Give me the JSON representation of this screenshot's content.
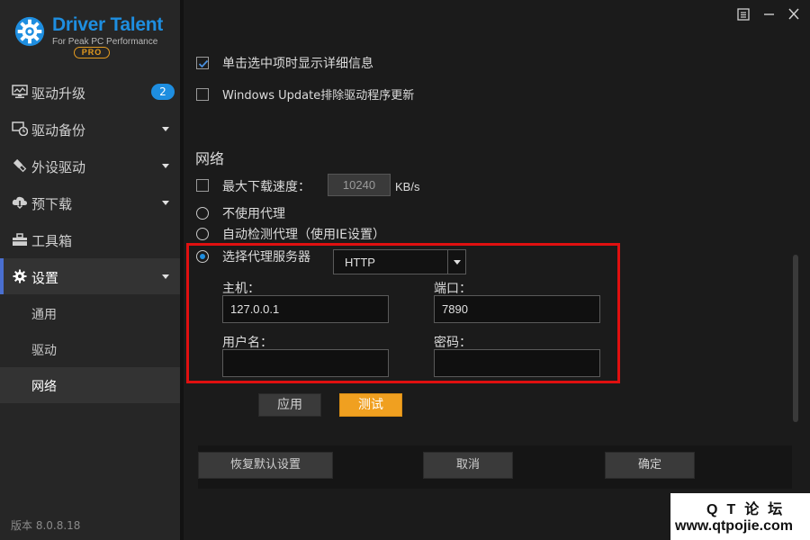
{
  "app": {
    "brand": "Driver Talent",
    "tagline": "For Peak PC Performance",
    "edition": "PRO",
    "version": "版本 8.0.8.18"
  },
  "sidebar": {
    "items": [
      {
        "label": "驱动升级",
        "icon": "monitor-icon",
        "badge": "2"
      },
      {
        "label": "驱动备份",
        "icon": "backup-clock-icon"
      },
      {
        "label": "外设驱动",
        "icon": "usb-icon"
      },
      {
        "label": "预下载",
        "icon": "cloud-download-icon"
      },
      {
        "label": "工具箱",
        "icon": "toolbox-icon"
      },
      {
        "label": "设置",
        "icon": "gear-icon"
      }
    ],
    "sub_items": [
      {
        "label": "通用"
      },
      {
        "label": "驱动"
      },
      {
        "label": "网络"
      }
    ]
  },
  "settings": {
    "option_single_click": "单击选中项时显示详细信息",
    "option_windows_update": "Windows Update排除驱动程序更新",
    "network_heading": "网络",
    "max_speed_label": "最大下载速度：",
    "max_speed_value": "10240",
    "max_speed_unit": "KB/s",
    "proxy_none": "不使用代理",
    "proxy_auto": "自动检测代理（使用IE设置）",
    "proxy_select": "选择代理服务器",
    "proxy_type": "HTTP",
    "host_label": "主机：",
    "host_value": "127.0.0.1",
    "port_label": "端口：",
    "port_value": "7890",
    "user_label": "用户名：",
    "user_value": "",
    "pass_label": "密码：",
    "pass_value": "",
    "apply_label": "应用",
    "test_label": "测试"
  },
  "footer": {
    "restore_label": "恢复默认设置",
    "cancel_label": "取消",
    "ok_label": "确定"
  },
  "watermark": {
    "line1": "QT论坛",
    "line2": "www.qtpojie.com"
  },
  "colors": {
    "accent_blue": "#1e8ee0",
    "accent_orange": "#f0a020",
    "highlight_red": "#e01010"
  }
}
